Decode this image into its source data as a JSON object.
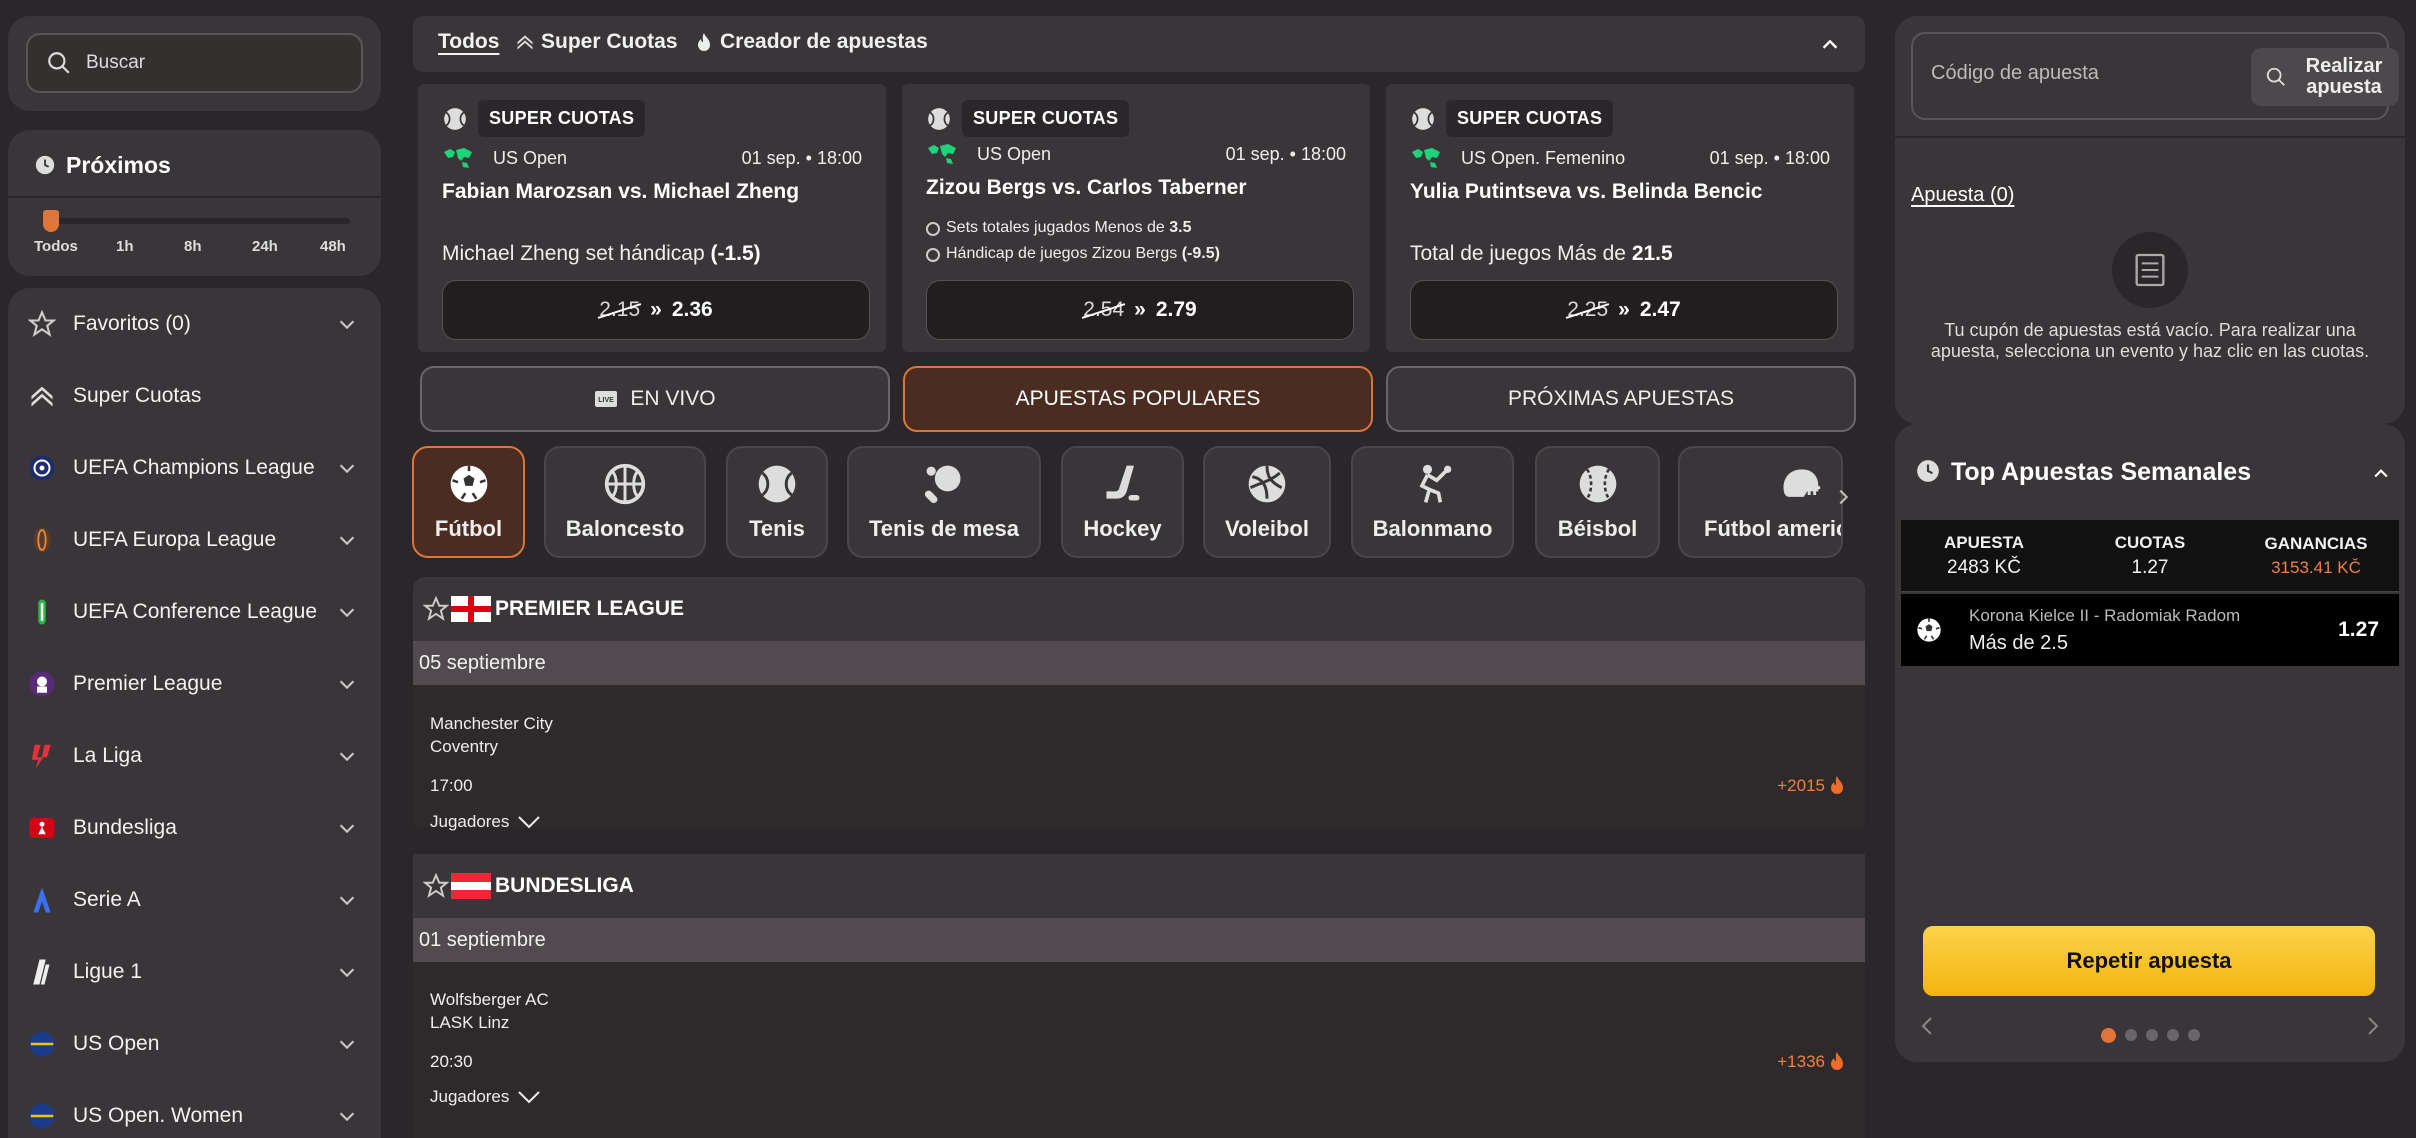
{
  "search": {
    "placeholder": "Buscar"
  },
  "upcoming": {
    "title": "Próximos",
    "slider_labels": [
      "Todos",
      "1h",
      "8h",
      "24h",
      "48h"
    ]
  },
  "sidebar": {
    "items": [
      {
        "label": "Favoritos (0)",
        "icon": "star-icon"
      },
      {
        "label": "Super Cuotas",
        "icon": "super-cuotas-icon"
      },
      {
        "label": "UEFA Champions League",
        "icon": "ucl-icon"
      },
      {
        "label": "UEFA Europa League",
        "icon": "uel-icon"
      },
      {
        "label": "UEFA Conference League",
        "icon": "uecl-icon"
      },
      {
        "label": "Premier League",
        "icon": "premier-league-icon"
      },
      {
        "label": "La Liga",
        "icon": "laliga-icon"
      },
      {
        "label": "Bundesliga",
        "icon": "bundesliga-icon"
      },
      {
        "label": "Serie A",
        "icon": "serie-a-icon"
      },
      {
        "label": "Ligue 1",
        "icon": "ligue-1-icon"
      },
      {
        "label": "US Open",
        "icon": "us-open-icon"
      },
      {
        "label": "US Open. Women",
        "icon": "us-open-icon"
      }
    ]
  },
  "top_tabs": {
    "todos": "Todos",
    "super_cuotas": "Super Cuotas",
    "creador": "Creador de apuestas"
  },
  "super_cuotas": [
    {
      "badge": "SUPER CUOTAS",
      "competition": "US Open",
      "date": "01 sep. • 18:00",
      "match": "Fabian Marozsan vs. Michael Zheng",
      "market": "Michael Zheng set hándicap ",
      "market_bold": "(-1.5)",
      "old_odds": "2.15",
      "new_odds": "2.36"
    },
    {
      "badge": "SUPER CUOTAS",
      "competition": "US Open",
      "date": "01 sep. • 18:00",
      "match": "Zizou Bergs vs. Carlos Taberner",
      "line1": "Sets totales jugados Menos de ",
      "line1_bold": "3.5",
      "line2": "Hándicap de juegos Zizou Bergs ",
      "line2_bold": "(-9.5)",
      "old_odds": "2.54",
      "new_odds": "2.79"
    },
    {
      "badge": "SUPER CUOTAS",
      "competition": "US Open. Femenino",
      "date": "01 sep. • 18:00",
      "match": "Yulia Putintseva vs. Belinda Bencic",
      "market": "Total de juegos Más de ",
      "market_bold": "21.5",
      "old_odds": "2.25",
      "new_odds": "2.47"
    }
  ],
  "categories": {
    "live": "EN VIVO",
    "popular": "APUESTAS POPULARES",
    "upcoming": "PRÓXIMAS APUESTAS"
  },
  "sports": [
    "Fútbol",
    "Baloncesto",
    "Tenis",
    "Tenis de mesa",
    "Hockey",
    "Voleibol",
    "Balonmano",
    "Béisbol",
    "Fútbol americano"
  ],
  "leagues": [
    {
      "name": "PREMIER LEAGUE",
      "date": "05 septiembre",
      "home": "Manchester City",
      "away": "Coventry",
      "time": "17:00",
      "players": "Jugadores",
      "count": "+2015"
    },
    {
      "name": "BUNDESLIGA",
      "date": "01 septiembre",
      "home": "Wolfsberger AC",
      "away": "LASK Linz",
      "time": "20:30",
      "players": "Jugadores",
      "count": "+1336"
    }
  ],
  "betslip": {
    "code_placeholder": "Código de apuesta",
    "realizar": "Realizar apuesta",
    "tab": "Apuesta (0)",
    "empty": "Tu cupón de apuestas está vacío. Para realizar una apuesta, selecciona un evento y haz clic en las cuotas."
  },
  "top_bets": {
    "title": "Top Apuestas Semanales",
    "headers": {
      "stake": "APUESTA",
      "odds": "CUOTAS",
      "win": "GANANCIAS"
    },
    "values": {
      "stake": "2483 KČ",
      "odds": "1.27",
      "win": "3153.41 KČ"
    },
    "row": {
      "match": "Korona Kielce II - Radomiak Radom",
      "market": "Más de 2.5",
      "odds": "1.27"
    },
    "repeat": "Repetir apuesta",
    "pages": 5,
    "active_page": 1
  },
  "colors": {
    "accent": "#e0753a",
    "cta": "#f7c327",
    "panel": "#3a3538",
    "background": "#2b2629"
  }
}
